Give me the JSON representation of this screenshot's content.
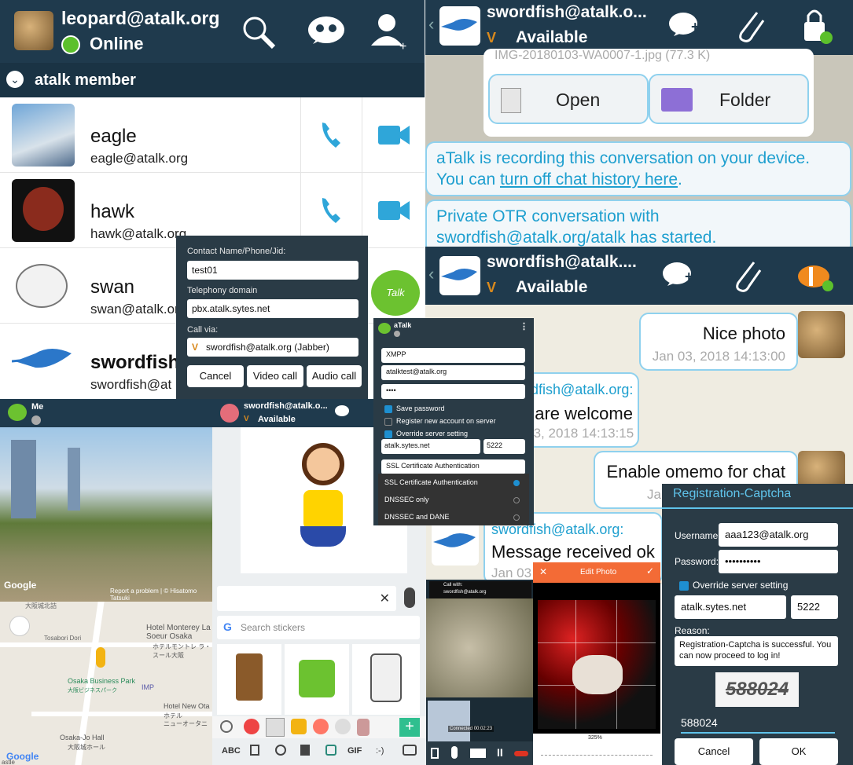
{
  "contacts_panel": {
    "account": "leopard@atalk.org",
    "status": "Online",
    "group": "atalk member",
    "contacts": [
      {
        "name": "eagle",
        "jid": "eagle@atalk.org"
      },
      {
        "name": "hawk",
        "jid": "hawk@atalk.org"
      },
      {
        "name": "swan",
        "jid": "swan@atalk.org"
      },
      {
        "name": "swordfish",
        "jid": "swordfish@at"
      }
    ],
    "logo_text": "Talk"
  },
  "call_dialog": {
    "label_contact": "Contact Name/Phone/Jid:",
    "value_contact": "test01",
    "label_domain": "Telephony domain",
    "value_domain": "pbx.atalk.sytes.net",
    "label_via": "Call via:",
    "value_via": "swordfish@atalk.org (Jabber)",
    "buttons": [
      "Cancel",
      "Video call",
      "Audio call"
    ]
  },
  "chat_top": {
    "title": "swordfish@atalk.o...",
    "status": "Available",
    "file_caption": "IMG-20180103-WA0007-1.jpg (77.3 K)",
    "open_label": "Open",
    "folder_label": "Folder",
    "recording_prefix": "aTalk is recording this conversation on your device. You can ",
    "recording_link": "turn off chat history here",
    "recording_suffix": ".",
    "otr": "Private OTR conversation with swordfish@atalk.org/atalk has started."
  },
  "chat_second": {
    "title": "swordfish@atalk....",
    "status": "Available",
    "messages": [
      {
        "text": "Nice photo",
        "time": "Jan 03, 2018 14:13:00"
      },
      {
        "sender": "swordfish@atalk.org:",
        "text": "You are welcome",
        "time": "Jan 03, 2018 14:13:15"
      },
      {
        "text": "Enable omemo for chat",
        "time": "Jan 03"
      },
      {
        "sender": "swordfish@atalk.org:",
        "text": "Message received ok",
        "time": "Jan 03"
      }
    ]
  },
  "account_dialog": {
    "title": "aTalk",
    "protocol": "XMPP",
    "user": "atalktest@atalk.org",
    "password": "••••",
    "save_password": "Save password",
    "register": "Register new account on server",
    "override": "Override server setting",
    "server": "atalk.sytes.net",
    "port": "5222",
    "security_selected": "SSL Certificate Authentication",
    "security_options": [
      "SSL Certificate Authentication",
      "DNSSEC only",
      "DNSSEC and DANE"
    ]
  },
  "map_panel": {
    "title": "Me",
    "google": "Google",
    "report": "Report a problem",
    "copyright": "© Hisatomo Tatsuki",
    "labels": [
      "大阪城北詰",
      "Tosabori Dori",
      "Hotel Monterey La Soeur Osaka",
      "ホテルモントレ ラ・スール大阪",
      "Osaka Business Park",
      "大阪ビジネスパーク",
      "IMP",
      "Hotel New Ota",
      "ホテル",
      "ニューオータニ",
      "Osaka-Jo Hall",
      "大阪城ホール",
      "astle"
    ]
  },
  "sticker_panel": {
    "title": "swordfish@atalk.o...",
    "status": "Available",
    "search_placeholder": "Search stickers",
    "keys": [
      "ABC",
      "GIF",
      ":-)"
    ]
  },
  "video_panel": {
    "call_with": "Call with:",
    "callee": "swordfish@atalk.org",
    "connected": "Connected 00:02:23"
  },
  "edit_photo": {
    "title": "Edit Photo",
    "zoom": "325%"
  },
  "captcha": {
    "title": "Registration-Captcha",
    "username_label": "Username:",
    "username": "aaa123@atalk.org",
    "password_label": "Password:",
    "password": "••••••••••",
    "override": "Override server setting",
    "server": "atalk.sytes.net",
    "port": "5222",
    "reason_label": "Reason:",
    "reason": "Registration-Captcha is successful. You can now proceed to log in!",
    "captcha_image_text": "588024",
    "captcha_input": "588024",
    "cancel": "Cancel",
    "ok": "OK"
  },
  "colors": {
    "bar": "#1f3a4d",
    "accent": "#1e9fcf",
    "online": "#5cc02c"
  }
}
